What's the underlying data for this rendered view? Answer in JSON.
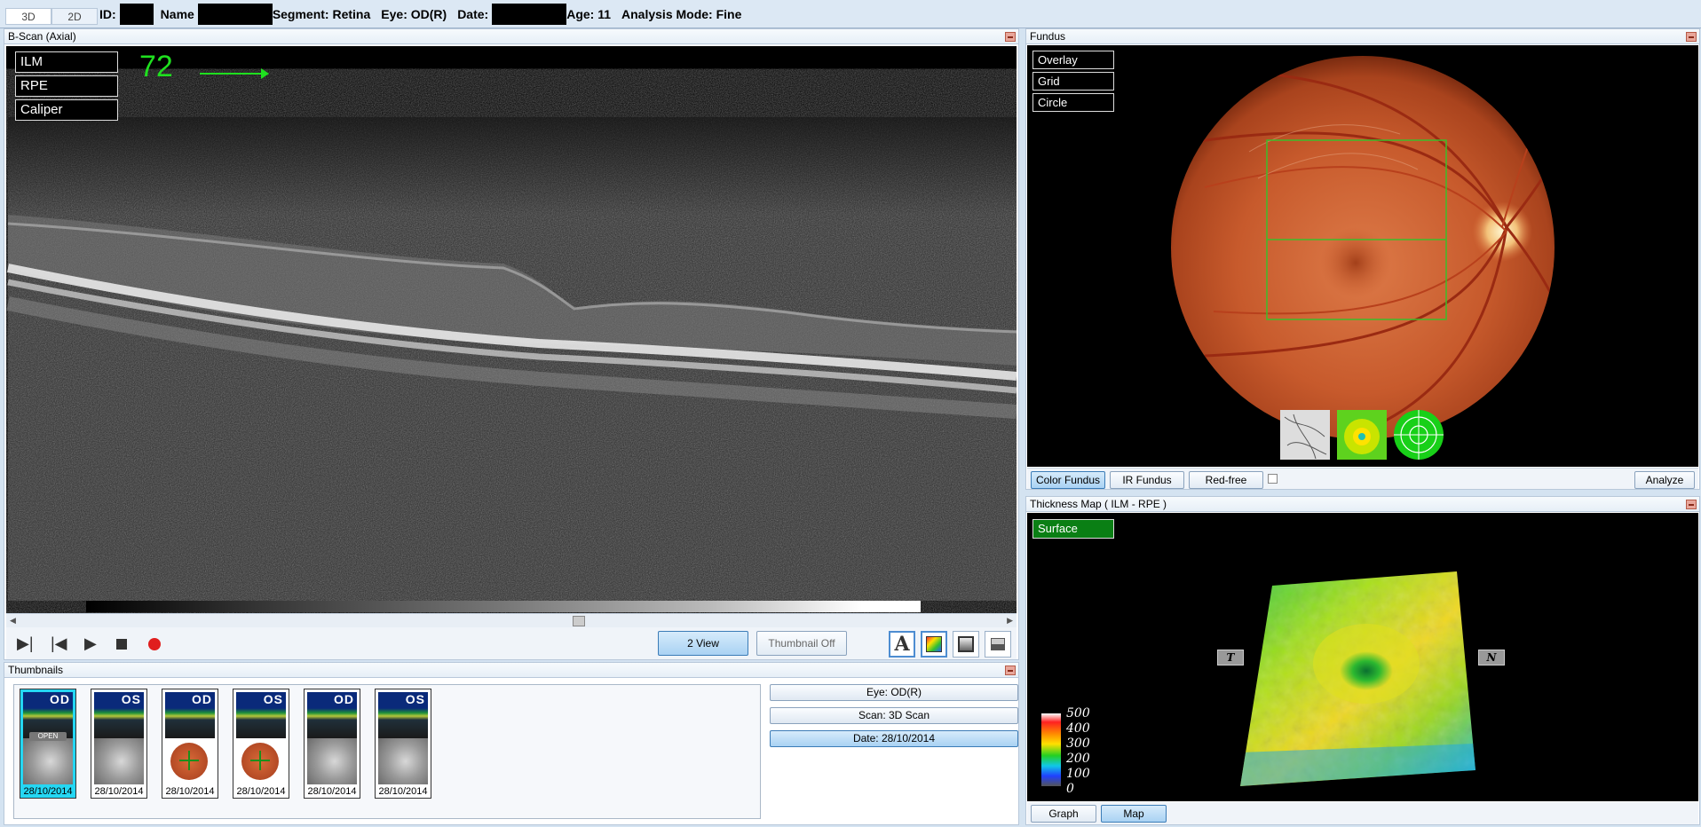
{
  "tabs": [
    {
      "label": "3D"
    },
    {
      "label": "2D"
    }
  ],
  "header": {
    "id_label": "ID:",
    "name_label": "Name",
    "segment": "Segment: Retina",
    "eye": "Eye: OD(R)",
    "date_label": "Date:",
    "age": "Age: 11",
    "analysis_mode": "Analysis Mode: Fine"
  },
  "bscan": {
    "title": "B-Scan (Axial)",
    "overlay_buttons": [
      "ILM",
      "RPE",
      "Caliper"
    ],
    "slice_number": "72",
    "two_view_button": "2 View",
    "thumbnail_button": "Thumbnail Off",
    "text_tool_glyph": "A"
  },
  "thumbnails": {
    "title": "Thumbnails",
    "items": [
      {
        "eye": "OD",
        "date": "28/10/2014",
        "badge": "OPEN",
        "selected": true,
        "fundus": "grey"
      },
      {
        "eye": "OS",
        "date": "28/10/2014",
        "badge": "",
        "selected": false,
        "fundus": "grey"
      },
      {
        "eye": "OD",
        "date": "28/10/2014",
        "badge": "",
        "selected": false,
        "fundus": "orange"
      },
      {
        "eye": "OS",
        "date": "28/10/2014",
        "badge": "",
        "selected": false,
        "fundus": "orange"
      },
      {
        "eye": "OD",
        "date": "28/10/2014",
        "badge": "",
        "selected": false,
        "fundus": "grey"
      },
      {
        "eye": "OS",
        "date": "28/10/2014",
        "badge": "",
        "selected": false,
        "fundus": "grey"
      }
    ],
    "side_buttons": [
      {
        "label": "Eye: OD(R)",
        "active": false
      },
      {
        "label": "Scan: 3D Scan",
        "active": false
      },
      {
        "label": "Date: 28/10/2014",
        "active": true
      }
    ]
  },
  "fundus": {
    "title": "Fundus",
    "overlay_buttons": [
      "Overlay",
      "Grid",
      "Circle"
    ],
    "mode_buttons": [
      {
        "label": "Color Fundus",
        "active": true
      },
      {
        "label": "IR Fundus",
        "active": false
      },
      {
        "label": "Red-free",
        "active": false
      }
    ],
    "analyze_button": "Analyze"
  },
  "thickness": {
    "title": "Thickness Map   ( ILM - RPE )",
    "surface_button": "Surface",
    "legend_labels": [
      "500",
      "400",
      "300",
      "200",
      "100",
      "0"
    ],
    "direction_left": "T",
    "direction_right": "N",
    "view_buttons": [
      {
        "label": "Graph",
        "active": false
      },
      {
        "label": "Map",
        "active": true
      }
    ]
  },
  "colors": {
    "accent_green": "#1fe01f",
    "selected_thumb": "#25d7f3",
    "surface_green": "#0a7f14",
    "record_red": "#e01e1e"
  }
}
